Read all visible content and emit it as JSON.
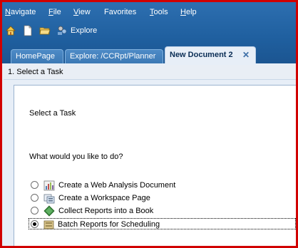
{
  "menu": [
    {
      "label": "Navigate",
      "ul": "N"
    },
    {
      "label": "File",
      "ul": "F"
    },
    {
      "label": "View",
      "ul": "V"
    },
    {
      "label": "Favorites",
      "ul": ""
    },
    {
      "label": "Tools",
      "ul": "T"
    },
    {
      "label": "Help",
      "ul": "H"
    }
  ],
  "toolbar": {
    "explore_label": "Explore"
  },
  "tabs": [
    {
      "label": "HomePage"
    },
    {
      "label": "Explore: /CCRpt/Planner"
    },
    {
      "label": "New Document 2",
      "close": "✕"
    }
  ],
  "step": {
    "label": "1. Select a Task"
  },
  "panel": {
    "title": "Select a Task",
    "question": "What would you like to do?",
    "options": [
      {
        "label": "Create a Web Analysis Document",
        "selected": false
      },
      {
        "label": "Create a Workspace Page",
        "selected": false
      },
      {
        "label": "Collect Reports into a Book",
        "selected": false
      },
      {
        "label": "Batch Reports for Scheduling",
        "selected": true
      }
    ]
  },
  "colors": {
    "header": "#1f5f9f",
    "frame": "#d10000",
    "content_bg": "#e7eef7"
  }
}
